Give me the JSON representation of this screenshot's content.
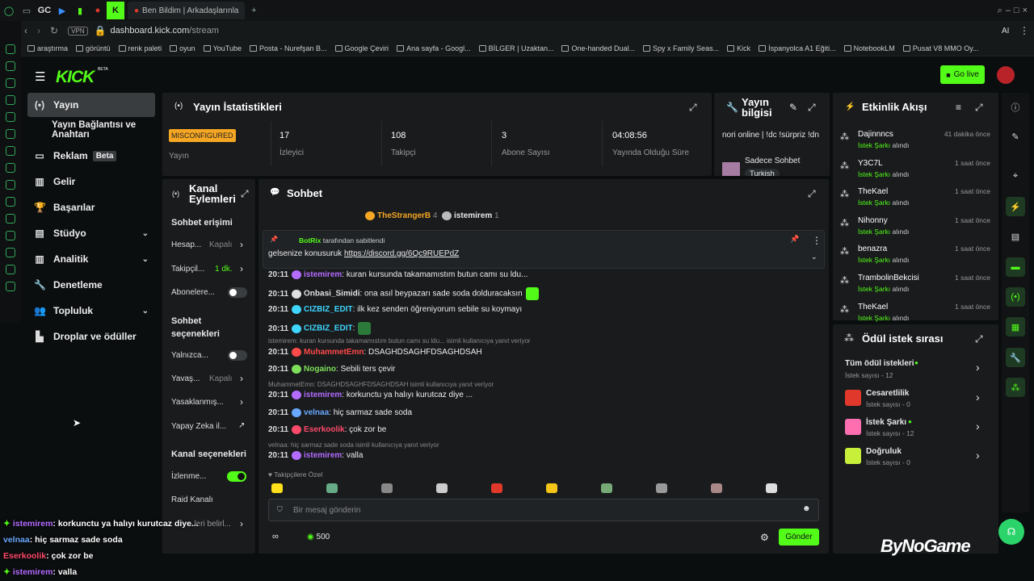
{
  "browser": {
    "tab_title": "Ben Bildim | Arkadaşlarınla",
    "url_host": "dashboard.kick.com",
    "url_path": "/stream",
    "vpn": "VPN",
    "gc": "GC",
    "ai": "AI",
    "bookmarks": [
      "araştırma",
      "görüntü",
      "renk paleti",
      "oyun",
      "YouTube",
      "Posta - Nurefşan B...",
      "Google Çeviri",
      "Ana sayfa - Googl...",
      "BİLGER | Uzaktan...",
      "One-handed Dual...",
      "Spy x Family Seas...",
      "Kick",
      "İspanyolca A1 Eğiti...",
      "NotebookLM",
      "Pusat V8 MMO Oy..."
    ]
  },
  "header": {
    "logo": "KICK",
    "beta": "BETA",
    "go_live": "Go live"
  },
  "nav": {
    "items": [
      {
        "label": "Yayın"
      },
      {
        "label": "Yayın Bağlantısı ve Anahtarı"
      },
      {
        "label": "Reklam",
        "badge": "Beta"
      },
      {
        "label": "Gelir"
      },
      {
        "label": "Başarılar"
      },
      {
        "label": "Stüdyo"
      },
      {
        "label": "Analitik"
      },
      {
        "label": "Denetleme"
      },
      {
        "label": "Topluluk"
      },
      {
        "label": "Droplar ve ödüller"
      }
    ]
  },
  "stats": {
    "title": "Yayın İstatistikleri",
    "status": "MISCONFIGURED",
    "status_label": "Yayın",
    "viewers": "17",
    "viewers_label": "İzleyici",
    "followers": "108",
    "followers_label": "Takipçi",
    "subs": "3",
    "subs_label": "Abone Sayısı",
    "uptime": "04:08:56",
    "uptime_label": "Yayında Olduğu Süre"
  },
  "info": {
    "title": "Yayın bilgisi",
    "stream_title": "nori online | !dc !sürpriz !dn",
    "category": "Sadece Sohbet",
    "tag": "Turkish"
  },
  "actions": {
    "title": "Kanal Eylemleri",
    "chat_access": "Sohbet erişimi",
    "hesap": "Hesap...",
    "hesap_val": "Kapalı",
    "takipci": "Takipçil...",
    "takipci_val": "1 dk.",
    "abone": "Abonelere...",
    "chat_opts": "Sohbet seçenekleri",
    "yalniz": "Yalnızca...",
    "yavas": "Yavaş...",
    "yavas_val": "Kapalı",
    "yasak": "Yasaklanmış...",
    "yz": "Yapay Zeka il...",
    "kanal_opts": "Kanal seçenekleri",
    "izlenme": "İzlenme...",
    "raid": "Raid Kanalı",
    "belirl": "...leri belirl..."
  },
  "chat": {
    "title": "Sohbet",
    "top1": "TheStrangerB",
    "top1n": "4",
    "top2": "istemirem",
    "top2n": "1",
    "pin_by": "BotRix",
    "pin_by_suffix": "tarafından sabitlendi",
    "pin_text": "gelsenize konusuruk",
    "pin_link": "https://discord.gg/6Qc9RUEPdZ",
    "messages": [
      {
        "time": "20:11",
        "user": "istemirem",
        "color": "#b46cff",
        "text": ": kuran kursunda takamamıstım butun camı su ldu..."
      },
      {
        "time": "20:11",
        "user": "Onbasi_Simidi",
        "color": "#e0e0e0",
        "text": ": ona asıl beypazarı sade soda dolduracaksın"
      },
      {
        "time": "20:11",
        "user": "CIZBIZ_EDIT",
        "color": "#3fd6ff",
        "text": ": ilk kez senden öğreniyorum sebile su koymayı"
      },
      {
        "time": "20:11",
        "user": "CIZBIZ_EDIT",
        "color": "#3fd6ff",
        "text": ":"
      },
      {
        "time": "20:11",
        "user": "MuhammetEmn",
        "color": "#ff4a4a",
        "text": ": DSAGHDSAGHFDSAGHDSAH"
      },
      {
        "time": "20:11",
        "user": "Nogaino",
        "color": "#7ee05a",
        "text": ": Sebili ters çevir"
      },
      {
        "time": "20:11",
        "user": "istemirem",
        "color": "#b46cff",
        "text": ": korkunctu ya halıyı kurutcaz diye ..."
      },
      {
        "time": "20:11",
        "user": "velnaa",
        "color": "#6aa8ff",
        "text": ": hiç sarmaz sade soda"
      },
      {
        "time": "20:11",
        "user": "Eserkoolik",
        "color": "#ff4a6a",
        "text": ": çok zor be"
      },
      {
        "time": "20:11",
        "user": "istemirem",
        "color": "#b46cff",
        "text": ": valla"
      }
    ],
    "replies": [
      "istemirem: kuran kursunda takamamıstım butun camı su ldu... isimli kullanıcıya yanıt veriyor",
      "MuhammetEmn: DSAGHDSAGHFDSAGHDSAH isimli kullanıcıya yanıt veriyor",
      "velnaa: hiç sarmaz sade soda isimli kullanıcıya yanıt veriyor"
    ],
    "followers_only": "Takipçilere Özel",
    "placeholder": "Bir mesaj gönderin",
    "points": "500",
    "send": "Gönder"
  },
  "events": {
    "title": "Etkinlik Akışı",
    "items": [
      {
        "name": "Dajinnncs",
        "time": "41 dakika önce"
      },
      {
        "name": "Y3C7L",
        "time": "1 saat önce"
      },
      {
        "name": "TheKael",
        "time": "1 saat önce"
      },
      {
        "name": "Nihonny",
        "time": "1 saat önce"
      },
      {
        "name": "benazra",
        "time": "1 saat önce"
      },
      {
        "name": "TrambolinBekcisi",
        "time": "1 saat önce"
      },
      {
        "name": "TheKael",
        "time": "1 saat önce"
      }
    ],
    "sub_prefix": "İstek Şarkı",
    "sub_suffix": "alındı"
  },
  "rewards": {
    "title": "Ödül istek sırası",
    "all": "Tüm ödül istekleri",
    "all_count": "İstek sayısı - 12",
    "items": [
      {
        "name": "Cesaretlilik",
        "count": "İstek sayısı - 0",
        "color": "#e0392b"
      },
      {
        "name": "İstek Şarkı",
        "count": "İstek sayısı - 12",
        "color": "#ff6fb0"
      },
      {
        "name": "Doğruluk",
        "count": "İstek sayısı - 0",
        "color": "#c8f03a"
      }
    ]
  },
  "overlay": [
    {
      "user": "istemirem",
      "text": ": korkunctu ya halıyı kurutcaz diye...",
      "color": "#b46cff"
    },
    {
      "user": "velnaa",
      "text": ": hiç sarmaz sade soda",
      "color": "#6aa8ff"
    },
    {
      "user": "Eserkoolik",
      "text": ": çok zor be",
      "color": "#ff4a6a"
    },
    {
      "user": "istemirem",
      "text": ": valla",
      "color": "#b46cff"
    }
  ],
  "watermark": "ByNoGame"
}
